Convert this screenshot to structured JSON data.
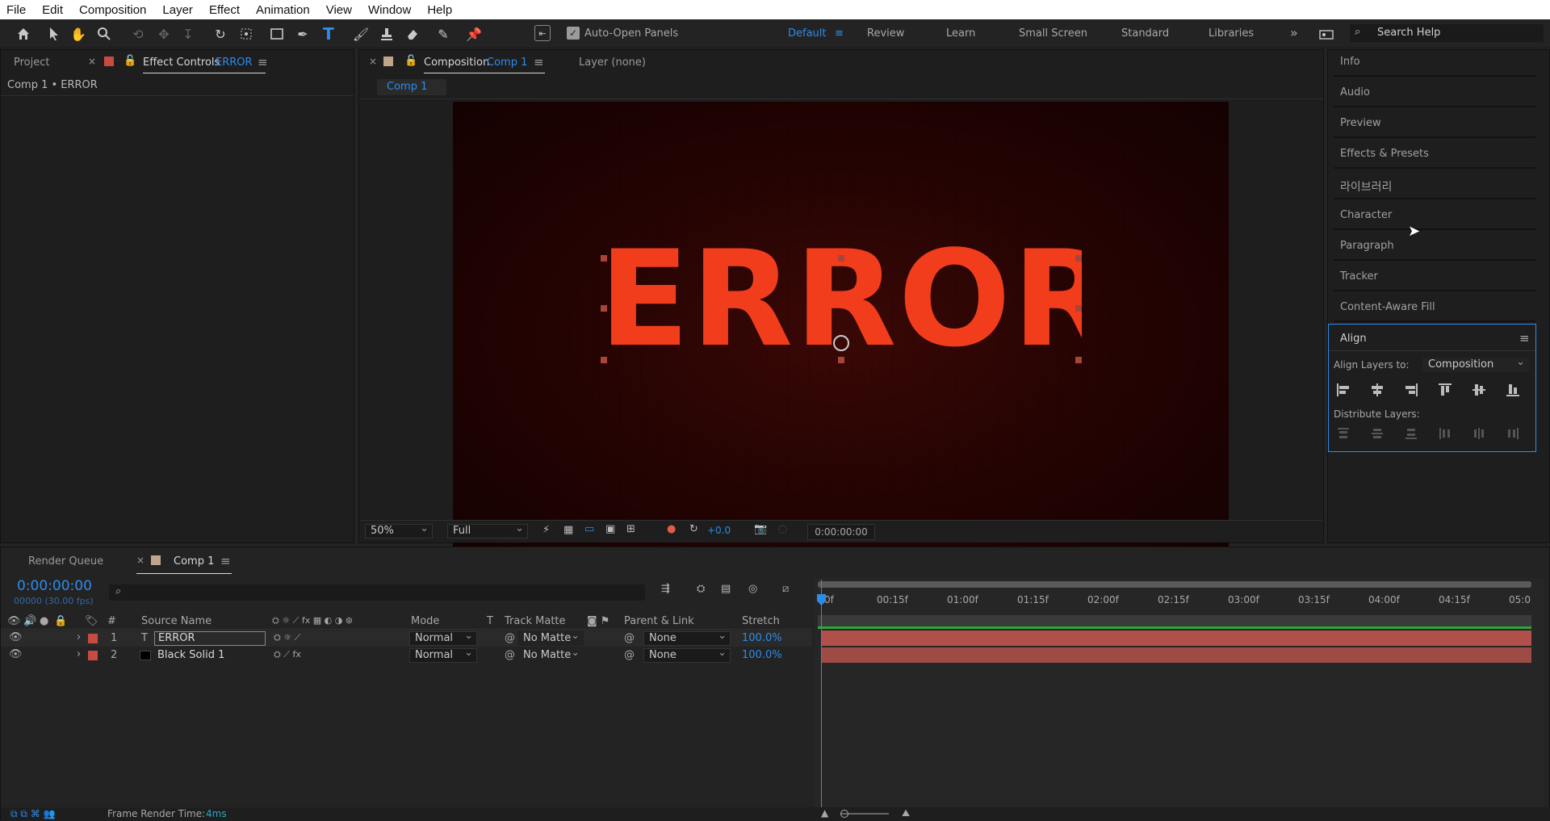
{
  "menu": [
    "File",
    "Edit",
    "Composition",
    "Layer",
    "Effect",
    "Animation",
    "View",
    "Window",
    "Help"
  ],
  "toolbar": {
    "auto_open_label": "Auto-Open Panels",
    "workspaces": [
      "Default",
      "Review",
      "Learn",
      "Small Screen",
      "Standard",
      "Libraries"
    ],
    "active_workspace": "Default",
    "search_placeholder": "Search Help"
  },
  "left_panel": {
    "tab_project": "Project",
    "tab_effect_controls": "Effect Controls",
    "effect_controls_target": "ERROR",
    "breadcrumb": "Comp 1 • ERROR"
  },
  "comp_panel": {
    "tab_composition": "Composition",
    "tab_composition_name": "Comp 1",
    "tab_layer": "Layer (none)",
    "subtab": "Comp 1",
    "canvas_text": "ERROR",
    "zoom": "50%",
    "resolution": "Full",
    "exposure": "+0.0",
    "timecode": "0:00:00:00"
  },
  "right_panel": {
    "items": [
      "Info",
      "Audio",
      "Preview",
      "Effects & Presets",
      "라이브러리",
      "Character",
      "Paragraph",
      "Tracker",
      "Content-Aware Fill"
    ],
    "align": {
      "title": "Align",
      "align_layers_label": "Align Layers to:",
      "align_target": "Composition",
      "distribute_label": "Distribute Layers:"
    }
  },
  "timeline": {
    "tab_render_queue": "Render Queue",
    "tab_comp": "Comp 1",
    "current_time": "0:00:00:00",
    "frame_info": "00000 (30.00 fps)",
    "headers": {
      "num": "#",
      "source": "Source Name",
      "mode": "Mode",
      "t": "T",
      "track_matte": "Track Matte",
      "parent": "Parent & Link",
      "stretch": "Stretch"
    },
    "ruler": [
      "0f",
      "00:15f",
      "01:00f",
      "01:15f",
      "02:00f",
      "02:15f",
      "03:00f",
      "03:15f",
      "04:00f",
      "04:15f",
      "05:0"
    ],
    "layers": [
      {
        "num": "1",
        "name": "ERROR",
        "mode": "Normal",
        "matte": "No Matte",
        "parent": "None",
        "stretch": "100.0%",
        "color": "#c84b3f"
      },
      {
        "num": "2",
        "name": "Black Solid 1",
        "mode": "Normal",
        "matte": "No Matte",
        "parent": "None",
        "stretch": "100.0%",
        "color": "#c84b3f"
      }
    ],
    "render_time_label": "Frame Render Time:",
    "render_time_value": "4ms"
  },
  "colors": {
    "accent": "#2d8ceb",
    "error_text": "#f23d1c",
    "label_red": "#c84b3f",
    "track_bar": "#b0504a"
  }
}
